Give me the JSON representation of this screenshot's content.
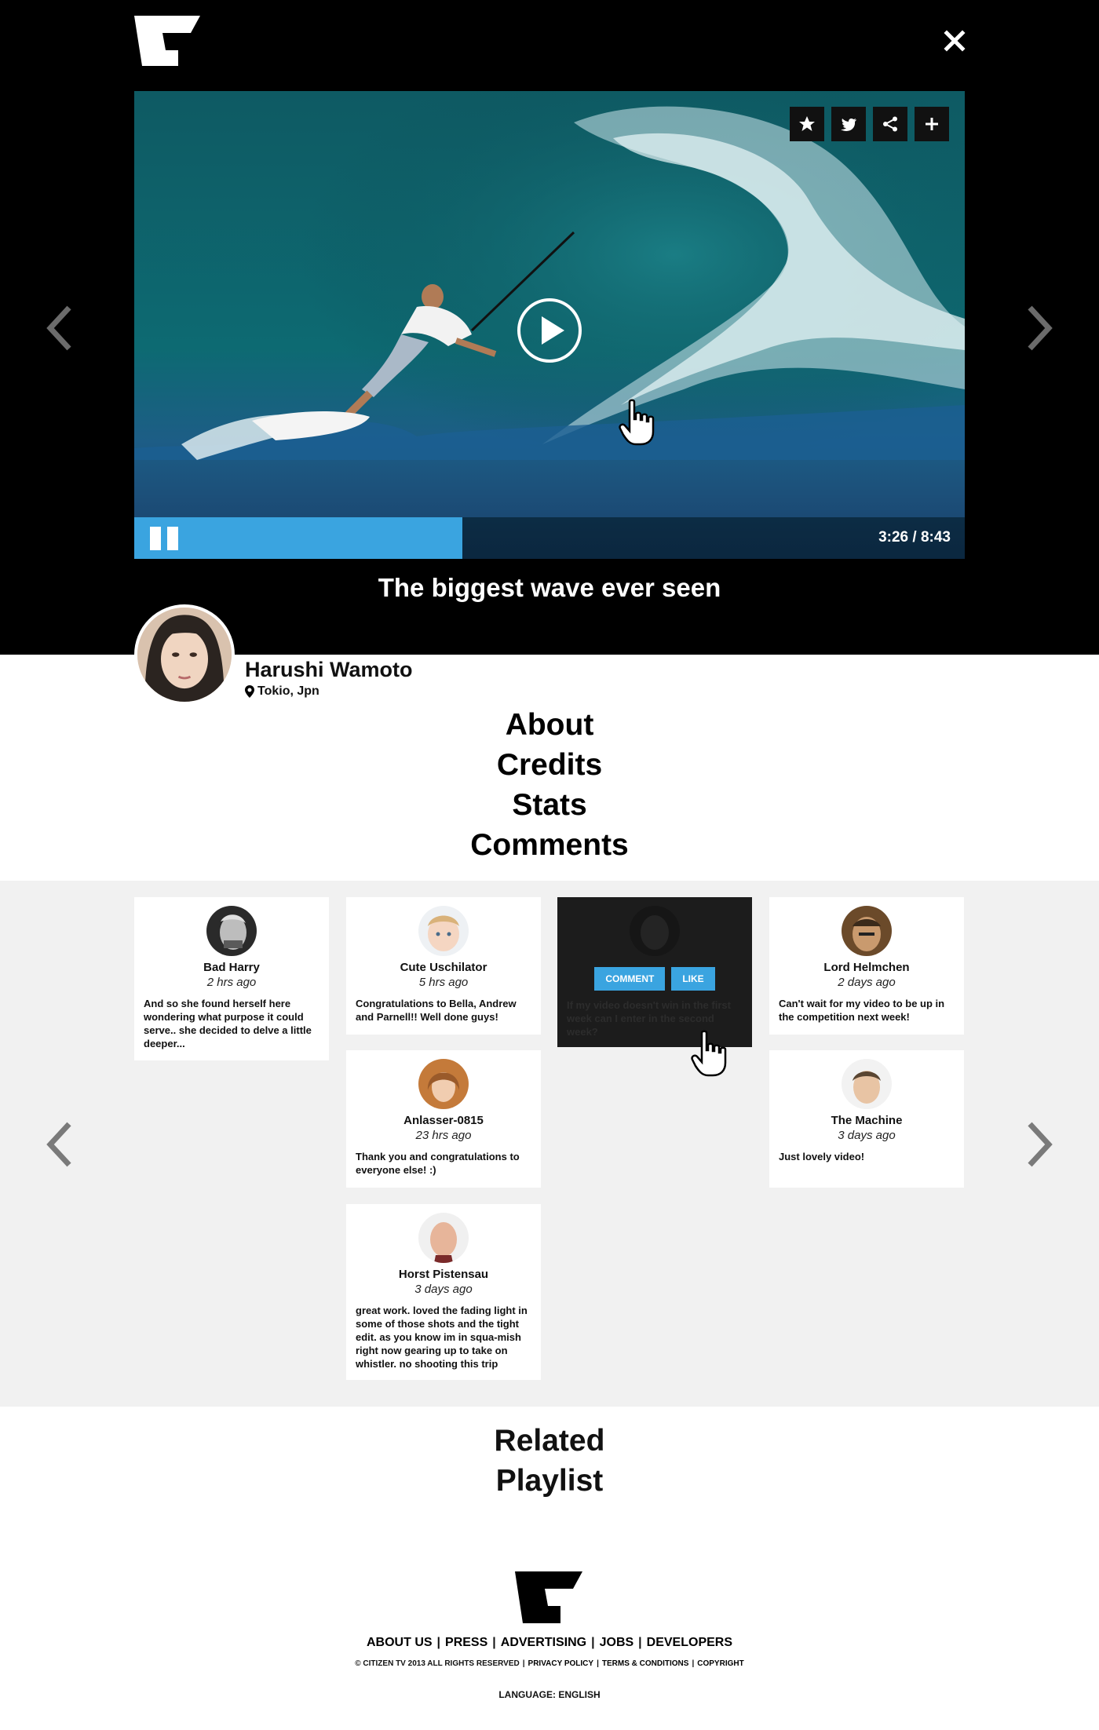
{
  "header": {
    "close_label": "×"
  },
  "video": {
    "title": "The biggest wave ever seen",
    "timecode": "3:26 / 8:43",
    "progress_fraction": 0.395,
    "share_buttons": [
      "star-icon",
      "twitter-icon",
      "share-icon",
      "plus-icon"
    ]
  },
  "author": {
    "name": "Harushi Wamoto",
    "location": "Tokio, Jpn"
  },
  "sections": [
    "About",
    "Credits",
    "Stats",
    "Comments"
  ],
  "comments": [
    {
      "name": "Bad Harry",
      "time": "2 hrs ago",
      "text": "And so she found herself here wondering what purpose it could serve.. she decided to delve a little deeper..."
    },
    {
      "name": "Cute Uschilator",
      "time": "5 hrs ago",
      "text": "Congratulations to Bella, Andrew and Parnell!! Well done guys!"
    },
    {
      "name": "",
      "time": "",
      "text": "If my video doesn't win in the first week can I enter in the second week?",
      "comment_label": "COMMENT",
      "like_label": "LIKE"
    },
    {
      "name": "Lord Helmchen",
      "time": "2 days ago",
      "text": "Can't wait for my video to be up in the competition next week!"
    },
    {
      "name": "Anlasser-0815",
      "time": "23 hrs ago",
      "text": "Thank you and congratulations to everyone else! :)"
    },
    {
      "name": "The Machine",
      "time": "3 days ago",
      "text": "Just lovely video!"
    },
    {
      "name": "Horst Pistensau",
      "time": "3 days ago",
      "text": "great work. loved the fading light in some of those shots and the tight edit. as you know im in squa-mish right now gearing up to take on whistler. no shooting this trip"
    }
  ],
  "related": {
    "line1": "Related",
    "line2": "Playlist"
  },
  "footer": {
    "links": [
      "ABOUT US",
      "PRESS",
      "ADVERTISING",
      "JOBS",
      "DEVELOPERS"
    ],
    "legal": [
      "© CITIZEN TV 2013 ALL RIGHTS RESERVED",
      "PRIVACY POLICY",
      "TERMS & CONDITIONS",
      "COPYRIGHT"
    ],
    "separator": "|",
    "language": "LANGUAGE: ENGLISH"
  },
  "colors": {
    "accent": "#3aa4e0",
    "dark": "#000000",
    "panel": "#f1f1f1"
  }
}
